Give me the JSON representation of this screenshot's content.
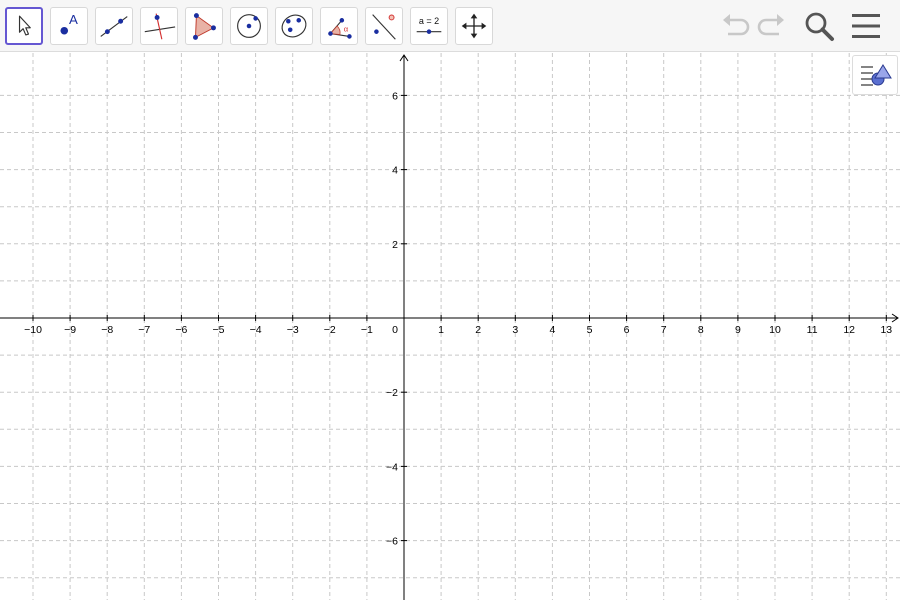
{
  "toolbar": {
    "tools": [
      {
        "name": "move-tool",
        "selected": true
      },
      {
        "name": "point-tool",
        "label": "A"
      },
      {
        "name": "line-tool"
      },
      {
        "name": "perpendicular-line-tool"
      },
      {
        "name": "polygon-tool"
      },
      {
        "name": "circle-tool"
      },
      {
        "name": "conic-tool"
      },
      {
        "name": "angle-tool",
        "label": "α"
      },
      {
        "name": "reflect-tool"
      },
      {
        "name": "slider-tool",
        "label": "a = 2"
      },
      {
        "name": "move-graphics-view-tool"
      }
    ],
    "header_icons": [
      "undo-icon",
      "redo-icon",
      "search-icon",
      "menu-icon"
    ]
  },
  "graphics_view": {
    "x_ticks": [
      "−10",
      "−9",
      "−8",
      "−7",
      "−6",
      "−5",
      "−4",
      "−3",
      "−2",
      "−1",
      "0",
      "1",
      "2",
      "3",
      "4",
      "5",
      "6",
      "7",
      "8",
      "9",
      "10",
      "11",
      "12",
      "13"
    ],
    "y_ticks": [
      "6",
      "4",
      "2",
      "−2",
      "−4",
      "−6"
    ],
    "x_range": [
      -11,
      13.5
    ],
    "y_range": [
      -7,
      6.5
    ],
    "grid": true,
    "grid_style": "dashed"
  },
  "colors": {
    "tool_selected_border": "#6557d2",
    "point_blue": "#1a2ea0",
    "accent_red": "#d32f2f",
    "polygon_fill": "#e8b2a6",
    "grid_line": "#c8c8c8",
    "axis": "#000000"
  },
  "stylebar": {
    "icon": "style-bar-toggle-icon"
  }
}
